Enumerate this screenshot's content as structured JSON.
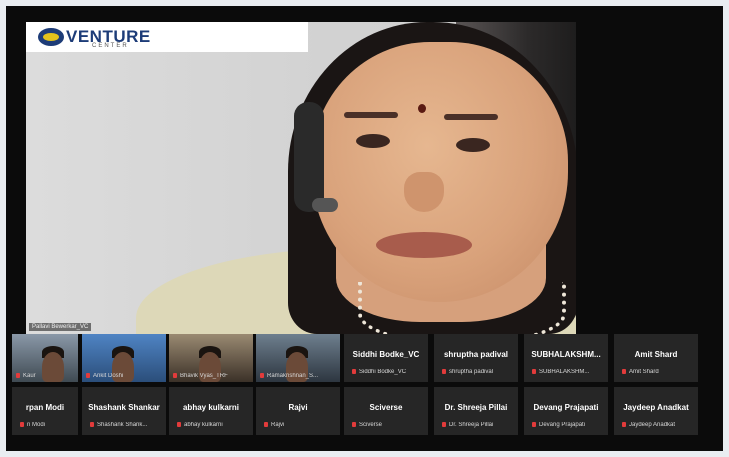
{
  "logo": {
    "main": "VENTURE",
    "sub": "CENTER"
  },
  "speaker": {
    "label": "Pallavi Bewerkar_VC"
  },
  "gallery": {
    "row1": [
      {
        "name": "",
        "footer": "Kaur",
        "video": true
      },
      {
        "name": "",
        "footer": "Ankit Doshi",
        "video": true
      },
      {
        "name": "",
        "footer": "Bhavik Vyas_TRF",
        "video": true
      },
      {
        "name": "",
        "footer": "Ramakrishnan_S...",
        "video": true,
        "active": true
      },
      {
        "name": "Siddhi Bodke_VC",
        "footer": "Siddhi Bodke_VC",
        "video": false
      },
      {
        "name": "shruptha padival",
        "footer": "shruptha padival",
        "video": false
      },
      {
        "name": "SUBHALAKSHM...",
        "footer": "SUBHALAKSHM...",
        "video": false
      },
      {
        "name": "Amit Shard",
        "footer": "Amit Shard",
        "video": false
      }
    ],
    "row2": [
      {
        "name": "rpan Modi",
        "footer": "n Modi"
      },
      {
        "name": "Shashank Shankar",
        "footer": "Shashank Shank..."
      },
      {
        "name": "abhay kulkarni",
        "footer": "abhay kulkarni"
      },
      {
        "name": "Rajvi",
        "footer": "Rajvi"
      },
      {
        "name": "Sciverse",
        "footer": "Sciverse"
      },
      {
        "name": "Dr. Shreeja Pillai",
        "footer": "Dr. Shreeja Pillai"
      },
      {
        "name": "Devang Prajapati",
        "footer": "Devang Prajapati"
      },
      {
        "name": "Jaydeep Anadkat",
        "footer": "Jaydeep Anadkat"
      }
    ]
  },
  "colors": {
    "background": "#0b0b0b",
    "tile": "#262626",
    "muted_mic": "#e23b3b",
    "active_border": "#6ed36e"
  }
}
